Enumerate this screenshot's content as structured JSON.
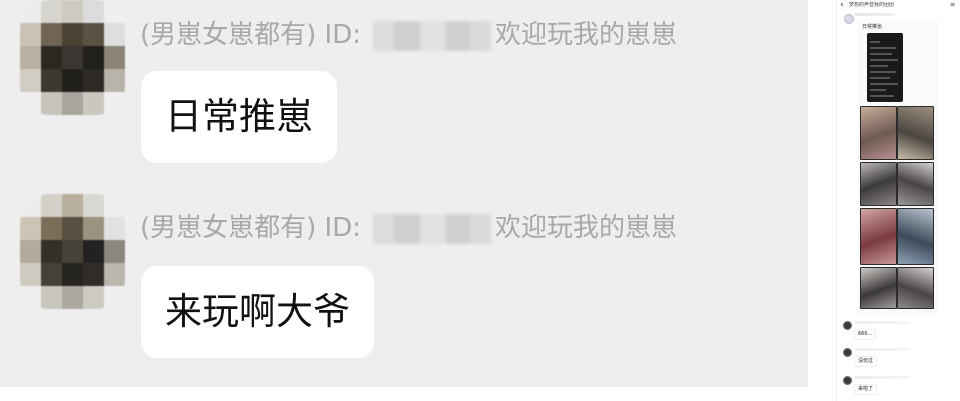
{
  "left_chat": {
    "messages": [
      {
        "sender_label": "(男崽女崽都有) ID:",
        "sender_suffix": "欢迎玩我的崽崽",
        "text": "日常推崽"
      },
      {
        "sender_label": "(男崽女崽都有) ID:",
        "sender_suffix": "欢迎玩我的崽崽",
        "text": "来玩啊大爷"
      }
    ]
  },
  "phone": {
    "title": "梦想的声音我的团团",
    "card_label": "日常推崽",
    "replies": [
      {
        "text": "666..."
      },
      {
        "text": "没玩过"
      },
      {
        "text": "来啦了"
      }
    ]
  },
  "colors": {
    "panel_bg": "#eeeeee",
    "bubble_bg": "#ffffff",
    "sender_text": "#a8a8a8"
  }
}
